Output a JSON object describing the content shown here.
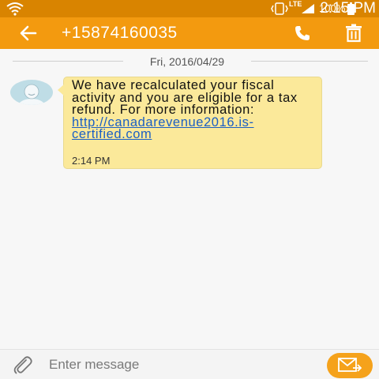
{
  "status_bar": {
    "network_label": "LTE",
    "battery_percent": "100%",
    "time": "2:15 PM"
  },
  "header": {
    "contact_number": "+15874160035",
    "icons": [
      "back-arrow-icon",
      "phone-icon",
      "trash-icon"
    ]
  },
  "conversation": {
    "date_separator": "Fri, 2016/04/29",
    "messages": [
      {
        "direction": "incoming",
        "text_before_link": "We have recalculated your fiscal activity and you are eligible for a tax refund. For more information: ",
        "link": "http://canadarevenue2016.is-certified.com",
        "time": "2:14 PM"
      }
    ]
  },
  "composer": {
    "placeholder": "Enter message",
    "icons": [
      "paperclip-icon",
      "send-envelope-icon"
    ]
  },
  "colors": {
    "status_bar": "#d98400",
    "app_bar": "#f39a0f",
    "bubble": "#fbe99a",
    "link": "#1b5fc4",
    "send_button": "#f5a21b"
  }
}
